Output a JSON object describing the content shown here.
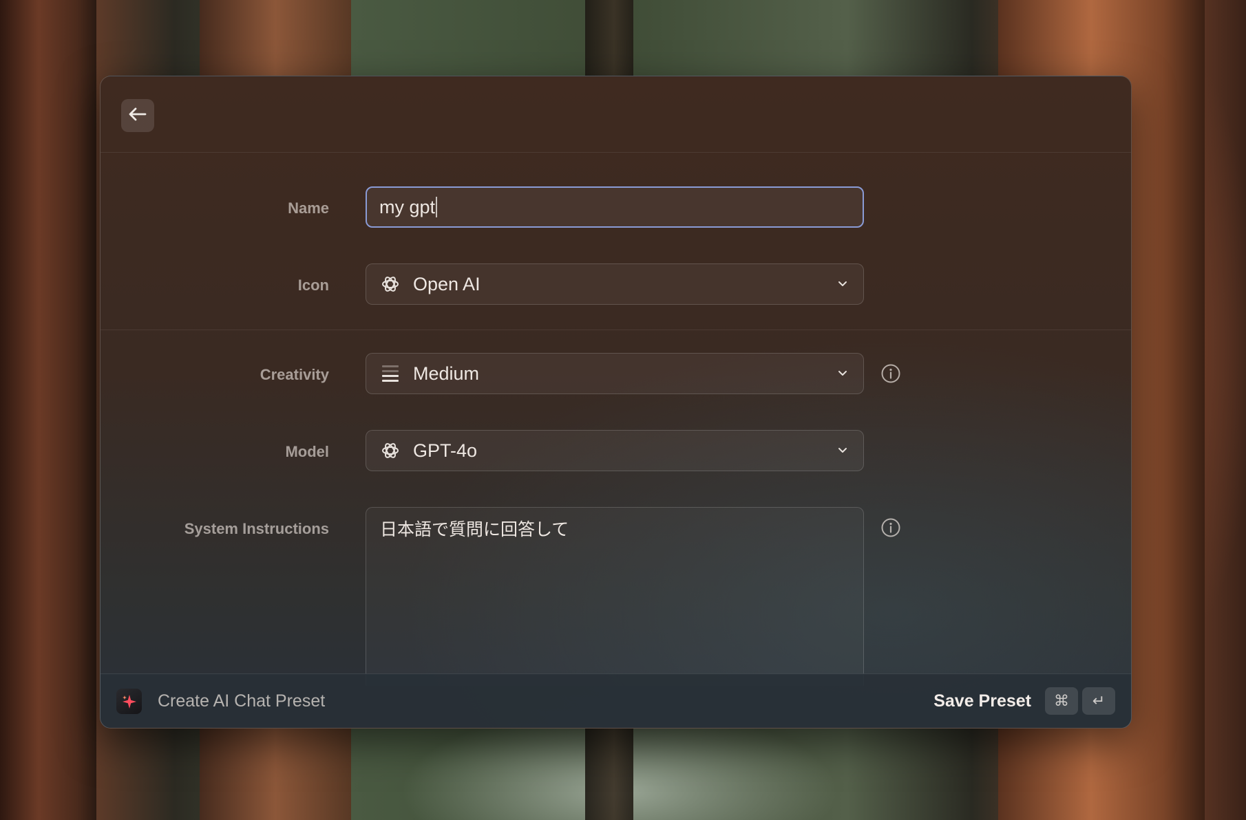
{
  "window": {
    "back_icon": "arrow-left-icon"
  },
  "form": {
    "name": {
      "label": "Name",
      "value": "my gpt"
    },
    "icon": {
      "label": "Icon",
      "value": "Open AI",
      "icon": "openai-icon"
    },
    "creativity": {
      "label": "Creativity",
      "value": "Medium",
      "icon": "medium-level-icon"
    },
    "model": {
      "label": "Model",
      "value": "GPT-4o",
      "icon": "openai-icon"
    },
    "system_instructions": {
      "label": "System Instructions",
      "value": "日本語で質問に回答して"
    }
  },
  "footer": {
    "title": "Create AI Chat Preset",
    "action_label": "Save Preset",
    "shortcut_cmd": "⌘",
    "shortcut_enter": "↵"
  },
  "colors": {
    "focus_border": "#8a9bd6",
    "app_icon_sparkle": "#ff4d5e"
  }
}
